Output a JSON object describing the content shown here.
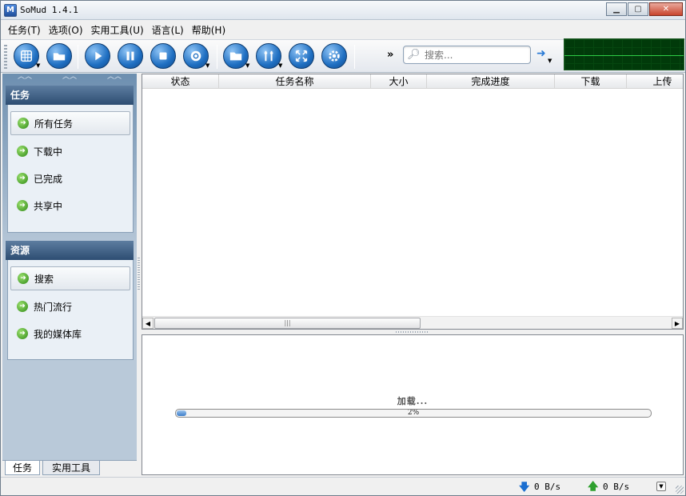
{
  "window": {
    "title": "SoMud 1.4.1",
    "app_icon": "somud-icon",
    "controls": [
      "minimize-icon",
      "maximize-icon",
      "close-icon"
    ]
  },
  "menu": [
    {
      "label": "任务(T)"
    },
    {
      "label": "选项(O)"
    },
    {
      "label": "实用工具(U)"
    },
    {
      "label": "语言(L)"
    },
    {
      "label": "帮助(H)"
    }
  ],
  "toolbar": {
    "buttons": [
      {
        "icon": "globe-icon",
        "dropdown": true
      },
      {
        "icon": "folder-open-icon",
        "dropdown": false
      },
      {
        "icon": "play-icon",
        "dropdown": false
      },
      {
        "icon": "pause-icon",
        "dropdown": false
      },
      {
        "icon": "stop-icon",
        "dropdown": false
      },
      {
        "icon": "recycle-icon",
        "dropdown": true
      },
      {
        "icon": "folder-icon",
        "dropdown": true
      },
      {
        "icon": "tools-icon",
        "dropdown": true
      },
      {
        "icon": "expand-icon",
        "dropdown": false
      },
      {
        "icon": "settings-gear-icon",
        "dropdown": false
      }
    ],
    "overflow": "»",
    "search_placeholder": "搜索..."
  },
  "sidebar": {
    "tasks_header": "任务",
    "task_items": [
      {
        "label": "所有任务",
        "selected": true
      },
      {
        "label": "下载中",
        "selected": false
      },
      {
        "label": "已完成",
        "selected": false
      },
      {
        "label": "共享中",
        "selected": false
      }
    ],
    "resources_header": "资源",
    "resource_items": [
      {
        "label": "搜索",
        "selected": true
      },
      {
        "label": "热门流行",
        "selected": false
      },
      {
        "label": "我的媒体库",
        "selected": false
      }
    ],
    "tabs": [
      {
        "label": "任务",
        "active": true
      },
      {
        "label": "实用工具",
        "active": false
      }
    ]
  },
  "task_list": {
    "columns": [
      "状态",
      "任务名称",
      "大小",
      "完成进度",
      "下载",
      "上传"
    ],
    "rows": []
  },
  "detail": {
    "loading_text": "加载...",
    "progress_label": "2%",
    "progress_value": 0.02
  },
  "statusbar": {
    "download_speed": "0 B/s",
    "upload_speed": "0 B/s"
  },
  "colors": {
    "graph_bg": "#013a0a",
    "graph_line": "#2ecc45",
    "panel_header": "#2d4d72",
    "accent_blue": "#1f6fc2"
  }
}
